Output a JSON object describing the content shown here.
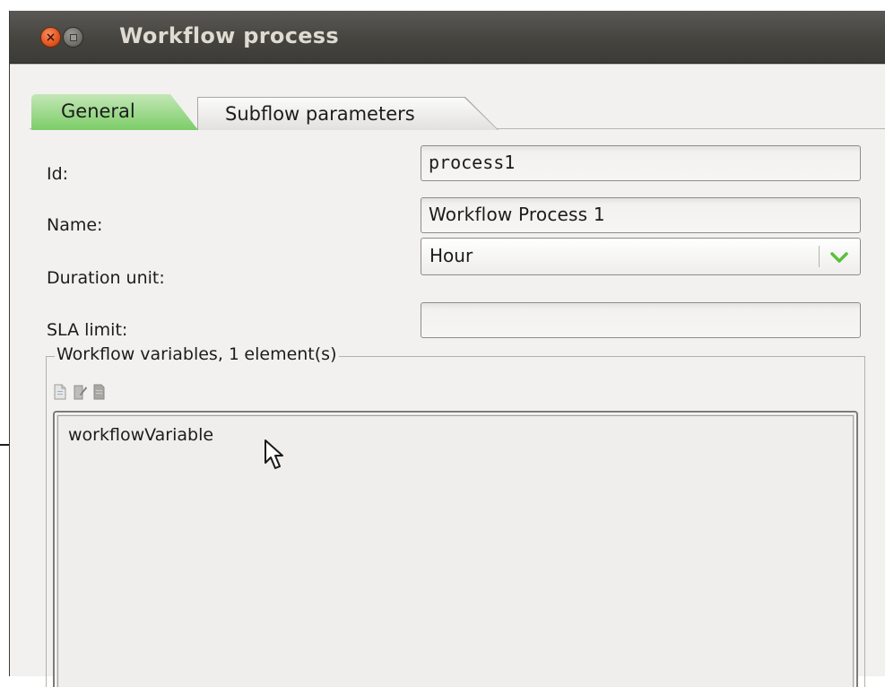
{
  "window": {
    "title": "Workflow process"
  },
  "tabs": [
    {
      "label": "General",
      "active": true,
      "color": "#7ccd68"
    },
    {
      "label": "Subflow parameters",
      "active": false
    }
  ],
  "form": {
    "id_label": "Id:",
    "id_value": "process1",
    "name_label": "Name:",
    "name_value": "Workflow Process 1",
    "duration_label": "Duration unit:",
    "duration_value": "Hour",
    "sla_label": "SLA limit:",
    "sla_value": ""
  },
  "variables": {
    "legend_prefix": "Workflow variables, ",
    "legend_count": "1",
    "legend_suffix": " element(s)",
    "toolbar_icons": [
      "new-document-icon",
      "edit-document-icon",
      "delete-document-icon"
    ],
    "items": [
      "workflowVariable"
    ]
  },
  "icons": {
    "close": "close-icon",
    "minimize": "minimize-icon",
    "dropdown": "chevron-down-icon",
    "cursor": "mouse-pointer-icon"
  },
  "colors": {
    "titlebar": "#45443f",
    "close_button": "#e2541f",
    "active_tab": "#7ccd68",
    "dropdown_chevron": "#5cbf3c"
  }
}
